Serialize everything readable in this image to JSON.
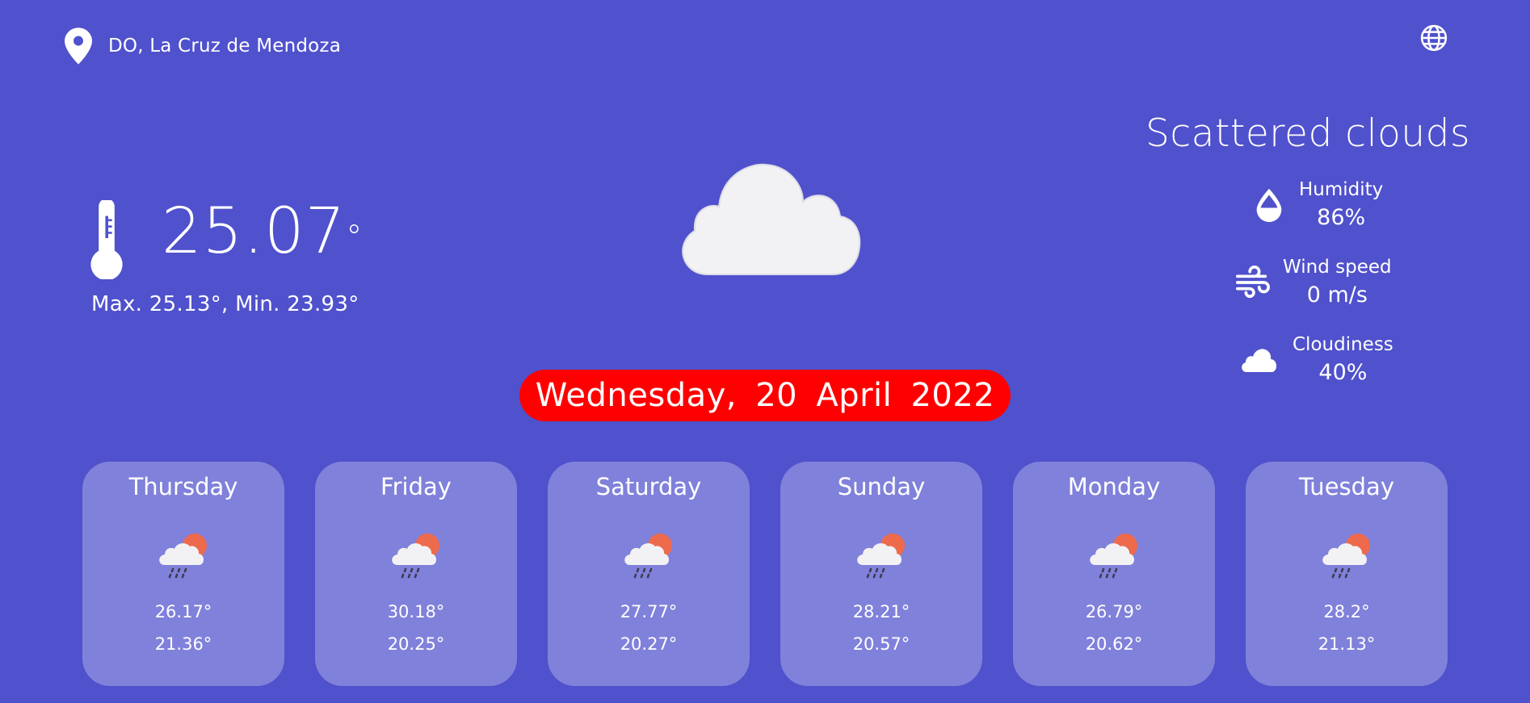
{
  "location": {
    "text": "DO, La Cruz de Mendoza",
    "icon": "map-pin-icon"
  },
  "language_button": {
    "icon": "globe-icon"
  },
  "current": {
    "temperature": "25.07",
    "degree_symbol": "°",
    "minmax": "Max. 25.13°, Min. 23.93°",
    "condition_icon": "cloud-icon",
    "description": "Scattered clouds",
    "stats": {
      "humidity": {
        "label": "Humidity",
        "value": "86%",
        "icon": "humidity-drop-icon"
      },
      "wind": {
        "label": "Wind speed",
        "value": "0 m/s",
        "icon": "wind-icon"
      },
      "cloudiness": {
        "label": "Cloudiness",
        "value": "40%",
        "icon": "cloudiness-icon"
      }
    }
  },
  "date": "Wednesday, 20 April 2022",
  "forecast": [
    {
      "day": "Thursday",
      "high": "26.17°",
      "low": "21.36°",
      "icon": "sun-cloud-rain-icon"
    },
    {
      "day": "Friday",
      "high": "30.18°",
      "low": "20.25°",
      "icon": "sun-cloud-rain-icon"
    },
    {
      "day": "Saturday",
      "high": "27.77°",
      "low": "20.27°",
      "icon": "sun-cloud-rain-icon"
    },
    {
      "day": "Sunday",
      "high": "28.21°",
      "low": "20.57°",
      "icon": "sun-cloud-rain-icon"
    },
    {
      "day": "Monday",
      "high": "26.79°",
      "low": "20.62°",
      "icon": "sun-cloud-rain-icon"
    },
    {
      "day": "Tuesday",
      "high": "28.2°",
      "low": "21.13°",
      "icon": "sun-cloud-rain-icon"
    }
  ],
  "colors": {
    "background": "#5051cc",
    "date_pill": "#ff0000",
    "card": "rgba(255,255,255,0.28)",
    "sun": "#ee6a4d",
    "cloud": "#f2f2f4",
    "rain": "#3b3b55"
  }
}
